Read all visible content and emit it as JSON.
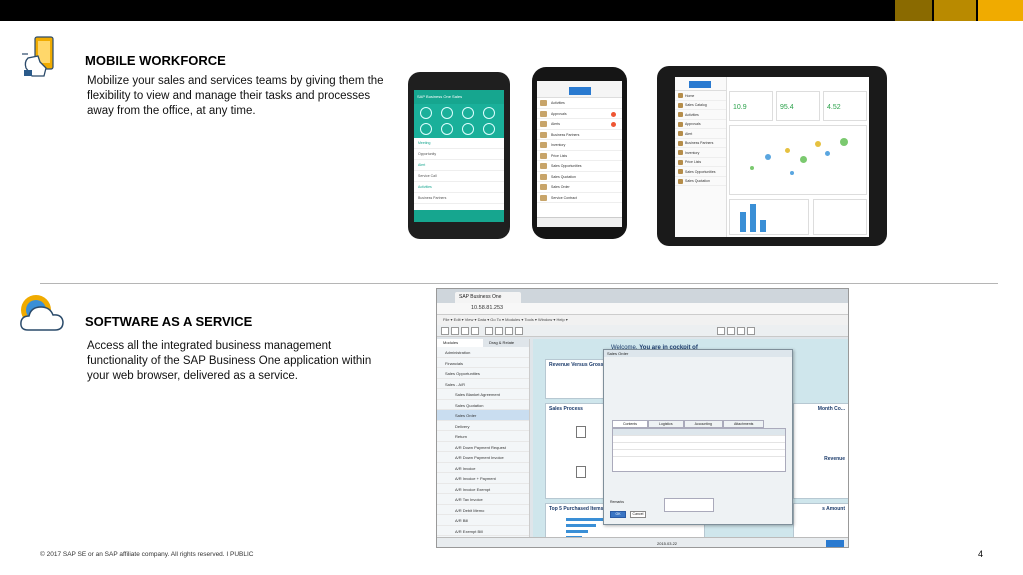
{
  "sections": [
    {
      "title": "MOBILE WORKFORCE",
      "description": "Mobilize your sales and services teams by giving them the flexibility to view and manage their tasks and processes away from the office, at any time.",
      "icon": "mobile-hand-icon"
    },
    {
      "title": "SOFTWARE AS A SERVICE",
      "description": "Access all the integrated business management functionality of the SAP Business One application within your web browser, delivered as a service.",
      "icon": "cloud-icon"
    }
  ],
  "footer": {
    "copyright": "© 2017 SAP SE or an SAP affiliate company. All rights reserved.  I   PUBLIC",
    "page_number": "4"
  },
  "colors": {
    "top_bar": "#000000",
    "swatch_1": "#8a6a00",
    "swatch_2": "#b98a00",
    "swatch_3": "#f0ab00",
    "android_accent": "#16a68f",
    "kpi_green": "#2aa14a",
    "browser_bg": "#cfe6ec"
  },
  "android": {
    "title": "SAP Business One Sales",
    "rows": [
      "Meeting",
      "Opportunity",
      "Alert",
      "Service Call",
      "Activities",
      "Business Partners"
    ]
  },
  "iphone": {
    "items": [
      "Activities",
      "Approvals",
      "Alerts",
      "Business Partners",
      "Inventory",
      "Price Lists",
      "Sales Opportunities",
      "Sales Quotation",
      "Sales Order",
      "Service Contract"
    ]
  },
  "ipad": {
    "menu": [
      "Home",
      "Sales Catalog",
      "Activities",
      "Approvals",
      "Alert",
      "Business Partners",
      "Inventory",
      "Price Lists",
      "Sales Opportunities",
      "Sales Quotation"
    ],
    "kpis": [
      "10.9",
      "95.4",
      "4.52"
    ]
  },
  "browser": {
    "tab": "SAP Business One",
    "url": "10.58.81.253",
    "menu": "File ▾  Edit ▾  View ▾  Data ▾  Go To ▾  Modules ▾  Tools ▾  Window ▾  Help ▾",
    "left_tabs": [
      "Modules",
      "Drag & Relate"
    ],
    "tree": [
      {
        "label": "Administration",
        "sub": false
      },
      {
        "label": "Financials",
        "sub": false
      },
      {
        "label": "Sales Opportunities",
        "sub": false
      },
      {
        "label": "Sales - A/R",
        "sub": false
      },
      {
        "label": "Sales Blanket Agreement",
        "sub": true
      },
      {
        "label": "Sales Quotation",
        "sub": true
      },
      {
        "label": "Sales Order",
        "sub": true,
        "selected": true
      },
      {
        "label": "Delivery",
        "sub": true
      },
      {
        "label": "Return",
        "sub": true
      },
      {
        "label": "A/R Down Payment Request",
        "sub": true
      },
      {
        "label": "A/R Down Payment Invoice",
        "sub": true
      },
      {
        "label": "A/R Invoice",
        "sub": true
      },
      {
        "label": "A/R Invoice + Payment",
        "sub": true
      },
      {
        "label": "A/R Invoice Exempt",
        "sub": true
      },
      {
        "label": "A/R Tax Invoice",
        "sub": true
      },
      {
        "label": "A/R Debit Memo",
        "sub": true
      },
      {
        "label": "A/R Bill",
        "sub": true
      },
      {
        "label": "A/R Exempt Bill",
        "sub": true
      },
      {
        "label": "A/R Export Invoice",
        "sub": true
      }
    ],
    "welcome_prefix": "Welcome,",
    "welcome_suffix": "You are in cockpit of",
    "panels": {
      "revenue": "Revenue Versus Gross Pro",
      "sales_process": "Sales Process",
      "top5": "Top 5 Purchased Items by",
      "month": "Month Co...",
      "revenue_right": "Revenue",
      "amount": "s Amount"
    },
    "dialog": {
      "title": "Sales Order",
      "tabs": [
        "Contents",
        "Logistics",
        "Accounting",
        "Attachments"
      ],
      "ok": "OK",
      "cancel": "Cancel",
      "remarks": "Remarks"
    },
    "status_date": "2015.03.22"
  }
}
